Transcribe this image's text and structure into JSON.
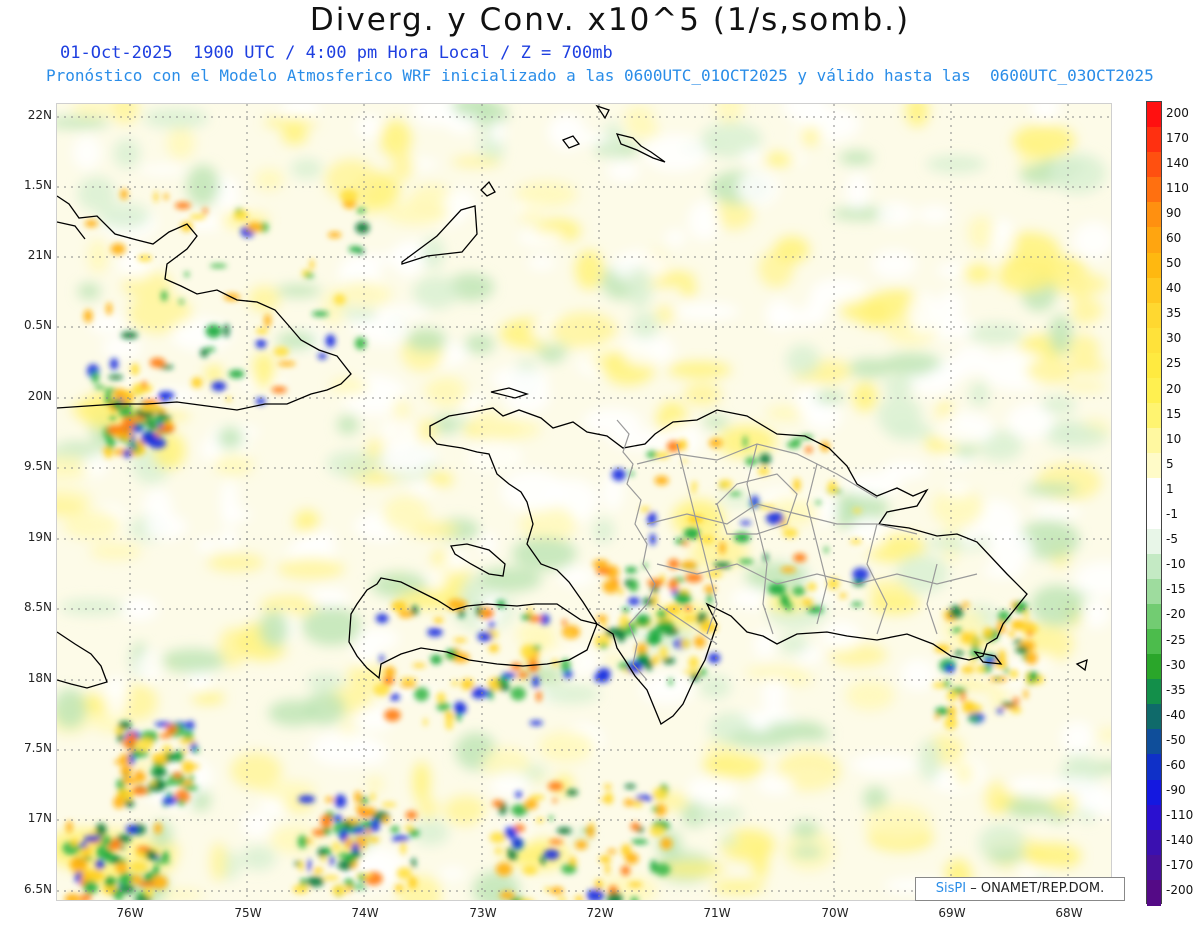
{
  "title": "Diverg. y Conv. x10^5 (1/s,somb.)",
  "subtitle_line1": "01-Oct-2025  1900 UTC / 4:00 pm Hora Local / Z = 700mb",
  "subtitle_line2": "Pronóstico con el Modelo Atmosferico WRF inicializado a las 0600UTC_01OCT2025 y válido hasta las  0600UTC_03OCT2025",
  "lat_labels": [
    "22N",
    "1.5N",
    "21N",
    "0.5N",
    "20N",
    "9.5N",
    "19N",
    "8.5N",
    "18N",
    "7.5N",
    "17N",
    "6.5N"
  ],
  "lon_labels": [
    "76W",
    "75W",
    "74W",
    "73W",
    "72W",
    "71W",
    "70W",
    "69W",
    "68W"
  ],
  "colorbar": {
    "labels": [
      "200",
      "170",
      "140",
      "110",
      "90",
      "60",
      "50",
      "40",
      "35",
      "30",
      "25",
      "20",
      "15",
      "10",
      "5",
      "1",
      "-1",
      "-5",
      "-10",
      "-15",
      "-20",
      "-25",
      "-30",
      "-35",
      "-40",
      "-50",
      "-60",
      "-90",
      "-110",
      "-140",
      "-170",
      "-200"
    ],
    "colors": [
      "#ff1010",
      "#ff3010",
      "#ff5010",
      "#ff7010",
      "#ff9010",
      "#ffa510",
      "#ffb810",
      "#ffc820",
      "#ffd830",
      "#ffe23a",
      "#ffea40",
      "#fff050",
      "#fff470",
      "#fff8a0",
      "#fffbc8",
      "#ffffff",
      "#ffffff",
      "#e8f6e8",
      "#c4eac4",
      "#9edc9e",
      "#72cc72",
      "#4cbc4c",
      "#2aa62a",
      "#138f4a",
      "#0f6a6a",
      "#0f4e9a",
      "#0f30c8",
      "#1418e0",
      "#2a10d0",
      "#3a10b0",
      "#48109a",
      "#540a86"
    ]
  },
  "credit": {
    "brand": "SisPI",
    "text": " – ONAMET/REP.DOM."
  }
}
